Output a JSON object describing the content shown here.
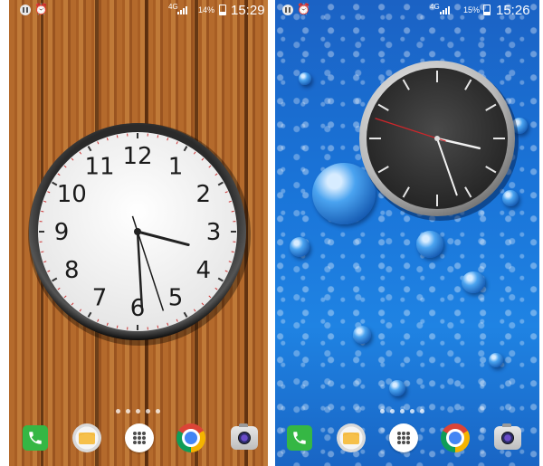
{
  "screens": [
    {
      "id": "left",
      "wallpaper": "wood-planks",
      "status_bar": {
        "icons": [
          "pause-icon",
          "alarm-icon",
          "signal-icon",
          "battery-icon"
        ],
        "network_label": "4G",
        "battery_percent": "14%",
        "time": "15:29"
      },
      "clock_widget": {
        "style": "white-analog",
        "numerals": [
          "12",
          "1",
          "2",
          "3",
          "4",
          "5",
          "6",
          "7",
          "8",
          "9",
          "10",
          "11"
        ],
        "time_shown": "15:29:27",
        "colors": {
          "face": "#f4f4f4",
          "bezel": "#141414",
          "second_hand": "#1a1a1a"
        }
      },
      "page_indicator_count": 5,
      "dock": [
        "phone-icon",
        "messages-icon",
        "apps-icon",
        "chrome-icon",
        "camera-icon"
      ]
    },
    {
      "id": "right",
      "wallpaper": "blue-water-droplets",
      "status_bar": {
        "icons": [
          "pause-icon",
          "alarm-icon",
          "signal-icon",
          "battery-icon"
        ],
        "network_label": "4G",
        "battery_percent": "15%",
        "time": "15:26"
      },
      "clock_widget": {
        "style": "dark-analog",
        "time_shown": "15:26:48",
        "colors": {
          "face": "#3a3a3a",
          "bezel": "#c8c8c8",
          "second_hand": "#d0262a"
        }
      },
      "page_indicator_count": 5,
      "dock": [
        "phone-icon",
        "messages-icon",
        "apps-icon",
        "chrome-icon",
        "camera-icon"
      ]
    }
  ]
}
